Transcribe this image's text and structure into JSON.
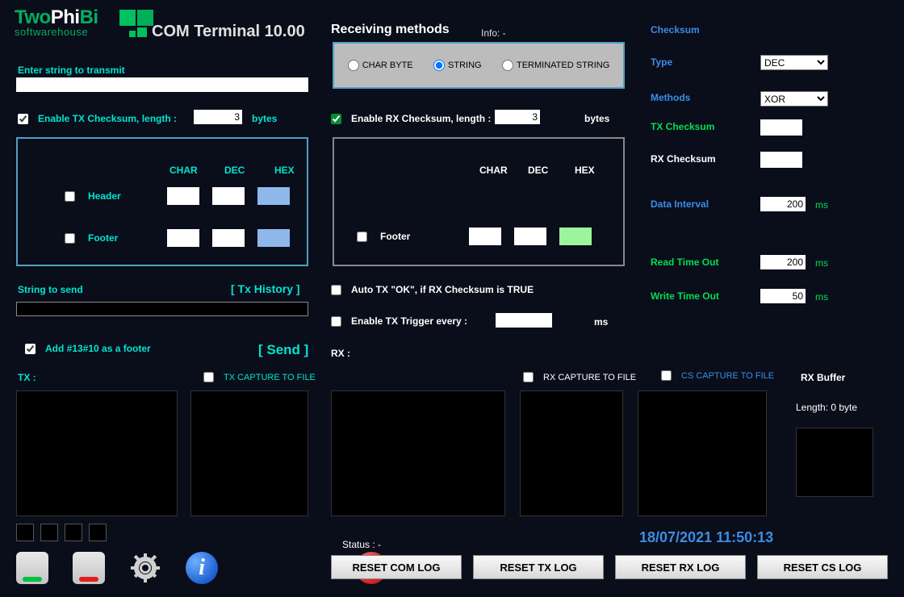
{
  "logo": {
    "brand": "TwoPhiBi",
    "sub": "softwarehouse"
  },
  "app_title": "COM Terminal 10.00",
  "left": {
    "enter_string_label": "Enter string to transmit",
    "en_tx_chk": "Enable TX Checksum, length :",
    "en_tx_len": "3",
    "bytes": "bytes",
    "cols": {
      "char": "CHAR",
      "dec": "DEC",
      "hex": "HEX"
    },
    "header": "Header",
    "footer": "Footer",
    "string_to_send": "String to send",
    "tx_history": "[ Tx History ]",
    "add1310": "Add #13#10 as a footer",
    "send": "[ Send ]",
    "tx_label": "TX :",
    "tx_capture": "TX CAPTURE TO FILE"
  },
  "middle": {
    "recv_title": "Receiving methods",
    "info": "Info: -",
    "radios": {
      "char_byte": "CHAR BYTE",
      "string": "STRING",
      "term": "TERMINATED STRING"
    },
    "en_rx_chk": "Enable RX Checksum, length :",
    "en_rx_len": "3",
    "bytes": "bytes",
    "footer": "Footer",
    "auto_tx": "Auto TX \"OK\", if RX Checksum is TRUE",
    "en_trig": "Enable TX Trigger every :",
    "trig_ms": "ms",
    "rx_label": "RX :",
    "rx_capture": "RX CAPTURE TO FILE",
    "cs_capture": "CS CAPTURE TO FILE",
    "status": "Status : -"
  },
  "right": {
    "checksum": "Checksum",
    "type": "Type",
    "type_val": "DEC",
    "methods": "Methods",
    "methods_val": "XOR",
    "tx_cs": "TX Checksum",
    "rx_cs": "RX Checksum",
    "data_interval": "Data Interval",
    "di": "200",
    "rto": "Read Time Out",
    "rto_v": "200",
    "wto": "Write Time Out",
    "wto_v": "50",
    "ms": "ms",
    "rxbuf": "RX Buffer",
    "rxbuf_len": "Length: 0 byte"
  },
  "datetime": "18/07/2021 11:50:13",
  "buttons": {
    "reset_com": "RESET COM LOG",
    "reset_tx": "RESET TX LOG",
    "reset_rx": "RESET RX LOG",
    "reset_cs": "RESET CS LOG"
  }
}
